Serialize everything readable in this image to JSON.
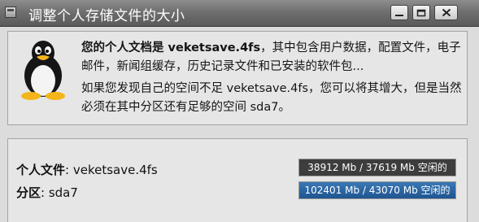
{
  "window": {
    "title": "调整个人存储文件的大小",
    "icons": {
      "app": "window-menu-icon",
      "minimize": "minimize-icon",
      "maximize": "maximize-icon",
      "close": "close-icon",
      "logo": "tux-penguin-icon"
    }
  },
  "info": {
    "line1_bold": "您的个人文档是 veketsave.4fs",
    "line1_rest": "，其中包含用户数据，配置文件，电子邮件，新闻组缓存，历史记录文件和已安装的软件包...",
    "line2": "如果您发现自己的空间不足 veketsave.4fs，您可以将其增大，但是当然必须在其中分区还有足够的空间 sda7。"
  },
  "details": {
    "personal": {
      "label": "个人文件",
      "value": ": veketsave.4fs",
      "usage_text": "38912 Mb / 37619 Mb 空闲的",
      "fill_fraction": 0.0
    },
    "partition": {
      "label": "分区",
      "value": ": sda7",
      "usage_text": "102401 Mb / 43070 Mb 空闲的",
      "fill_fraction": 1.0
    }
  },
  "colors": {
    "titlebar": "#6f6f6f",
    "bar_background": "#3d3d3d",
    "bar_fill": "#2a66a3"
  }
}
